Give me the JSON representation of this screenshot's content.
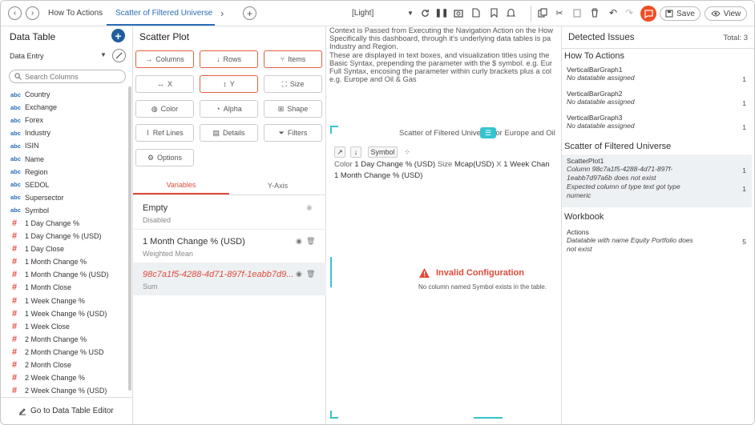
{
  "topbar": {
    "breadcrumb": "How To Actions",
    "active_tab": "Scatter of Filtered Universe",
    "light_label": "[Light]",
    "save_label": "Save",
    "view_label": "View"
  },
  "left_panel": {
    "title": "Data Table",
    "data_entry": "Data Entry",
    "search_placeholder": "Search Columns",
    "columns": [
      {
        "type": "abc",
        "name": "Country"
      },
      {
        "type": "abc",
        "name": "Exchange"
      },
      {
        "type": "abc",
        "name": "Forex"
      },
      {
        "type": "abc",
        "name": "Industry"
      },
      {
        "type": "abc",
        "name": "ISIN"
      },
      {
        "type": "abc",
        "name": "Name"
      },
      {
        "type": "abc",
        "name": "Region"
      },
      {
        "type": "abc",
        "name": "SEDOL"
      },
      {
        "type": "abc",
        "name": "Supersector"
      },
      {
        "type": "abc",
        "name": "Symbol"
      },
      {
        "type": "#",
        "name": "1 Day Change %"
      },
      {
        "type": "#",
        "name": "1 Day Change % (USD)"
      },
      {
        "type": "#",
        "name": "1 Day Close"
      },
      {
        "type": "#",
        "name": "1 Month Change %"
      },
      {
        "type": "#",
        "name": "1 Month Change % (USD)"
      },
      {
        "type": "#",
        "name": "1 Month Close"
      },
      {
        "type": "#",
        "name": "1 Week Change %"
      },
      {
        "type": "#",
        "name": "1 Week Change % (USD)"
      },
      {
        "type": "#",
        "name": "1 Week Close"
      },
      {
        "type": "#",
        "name": "2 Month Change %"
      },
      {
        "type": "#",
        "name": "2 Month Change % USD"
      },
      {
        "type": "#",
        "name": "2 Month Close"
      },
      {
        "type": "#",
        "name": "2 Week Change %"
      },
      {
        "type": "#",
        "name": "2 Week Change % (USD)"
      }
    ],
    "goto_label": "Go to Data Table Editor"
  },
  "mid_panel": {
    "title": "Scatter Plot",
    "buttons": {
      "columns": "Columns",
      "rows": "Rows",
      "items": "Items",
      "x": "X",
      "y": "Y",
      "size": "Size",
      "color": "Color",
      "alpha": "Alpha",
      "shape": "Shape",
      "ref_lines": "Ref Lines",
      "details": "Details",
      "filters": "Filters",
      "options": "Options"
    },
    "tabs": {
      "variables": "Variables",
      "yaxis": "Y-Axis"
    },
    "variables": [
      {
        "name": "Empty",
        "sub": "Disabled"
      },
      {
        "name": "1 Month Change % (USD)",
        "sub": "Weighted Mean"
      },
      {
        "name": "98c7a1f5-4288-4d71-897f-1eabb7d9...",
        "sub": "Sum"
      }
    ]
  },
  "canvas": {
    "context_lines": [
      "Context is Passed from Executing the Navigation Action on the How",
      "Specifically this dashboard, through it's underlying data tables is pa",
      "Industry and Region.",
      "These are displayed in text boxes, and visualization titles using the",
      "Basic Syntax, prepending the parameter with the $ symbol. e.g. Eur",
      "Full Syntax, encosing the parameter within curly brackets plus a col",
      "e.g. Europe and Oil & Gas"
    ],
    "scatter_title": "Scatter of Filtered Universe for Europe and Oil",
    "symbol_chip": "Symbol",
    "enc": {
      "color_label": "Color",
      "color_value": "1 Day Change % (USD)",
      "size_label": "Size",
      "size_value": "Mcap(USD)",
      "x_label": "X",
      "x_value": "1 Week Chan",
      "y_value": "1 Month Change % (USD)"
    },
    "invalid_title": "Invalid Configuration",
    "invalid_msg": "No column named Symbol exists in the table."
  },
  "issues_panel": {
    "title": "Detected Issues",
    "total": "Total: 3",
    "sections": {
      "how_to": "How To Actions",
      "scatter": "Scatter of Filtered Universe",
      "workbook": "Workbook"
    },
    "how_to_items": [
      {
        "name": "VerticalBarGraph1",
        "desc": "No datatable assigned",
        "count": "1"
      },
      {
        "name": "VerticalBarGraph2",
        "desc": "No datatable assigned",
        "count": "1"
      },
      {
        "name": "VerticalBarGraph3",
        "desc": "No datatable assigned",
        "count": "1"
      }
    ],
    "scatter_item": {
      "name": "ScatterPlot1",
      "desc1a": "Column 98c7a1f5-4288-4d71-897f-",
      "desc1b": "1eabb7d97a6b does not exist",
      "count1": "1",
      "desc2a": "Expected column of type text got type",
      "desc2b": "numeric",
      "count2": "1"
    },
    "workbook_item": {
      "name": "Actions",
      "desc_a": "Datatable with name Equity Portfolio does",
      "desc_b": "not exist",
      "count": "5"
    }
  }
}
